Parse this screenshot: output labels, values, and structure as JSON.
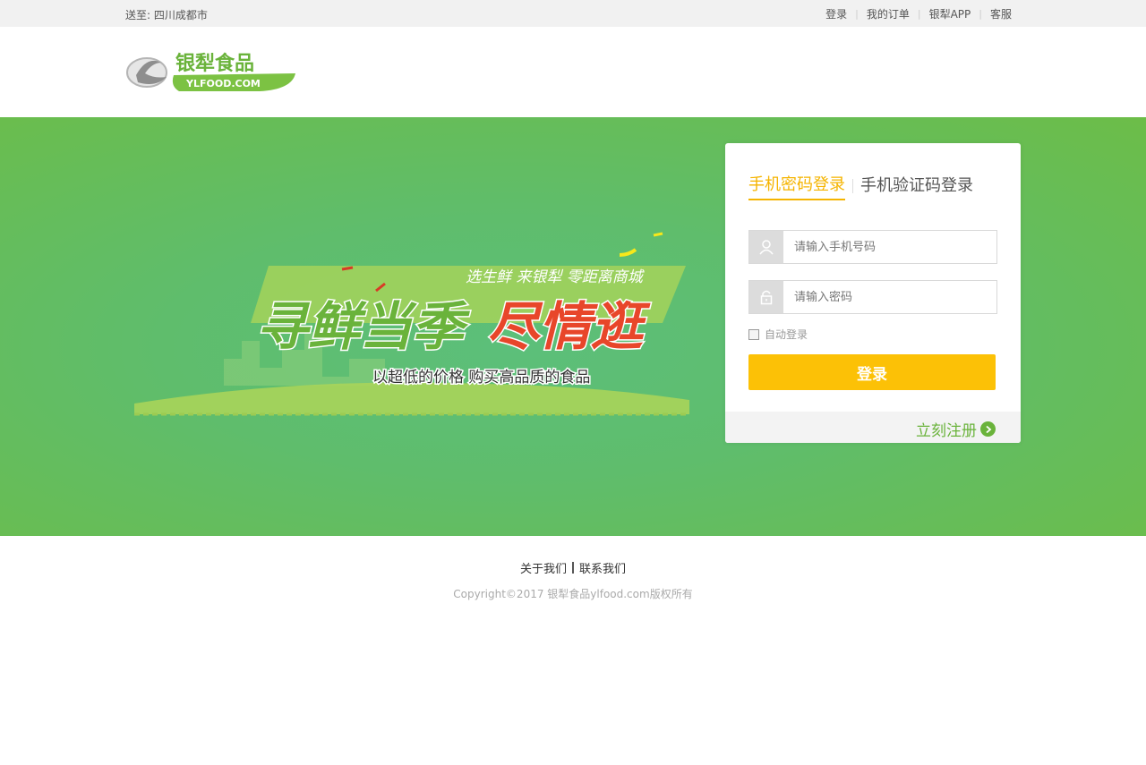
{
  "topbar": {
    "location": "送至: 四川成都市",
    "links": [
      "登录",
      "我的订单",
      "银犁APP",
      "客服"
    ]
  },
  "logo": {
    "text": "银犁食品",
    "domain": "YLFOOD.COM"
  },
  "banner": {
    "tagline": "选生鲜  来银犁  零距离商城",
    "headline_part1": "寻鲜当季",
    "headline_part2": "尽情逛",
    "subline": "以超低的价格    购买高品质的食品"
  },
  "login": {
    "tab_active": "手机密码登录",
    "tab_inactive": "手机验证码登录",
    "phone_placeholder": "请输入手机号码",
    "password_placeholder": "请输入密码",
    "auto_login": "自动登录",
    "login_button": "登录",
    "register": "立刻注册"
  },
  "footer": {
    "about": "关于我们",
    "contact": "联系我们",
    "copyright": "Copyright©2017 银犁食品ylfood.com版权所有"
  },
  "colors": {
    "accent_yellow": "#fcc106",
    "brand_green": "#6ab33b"
  }
}
